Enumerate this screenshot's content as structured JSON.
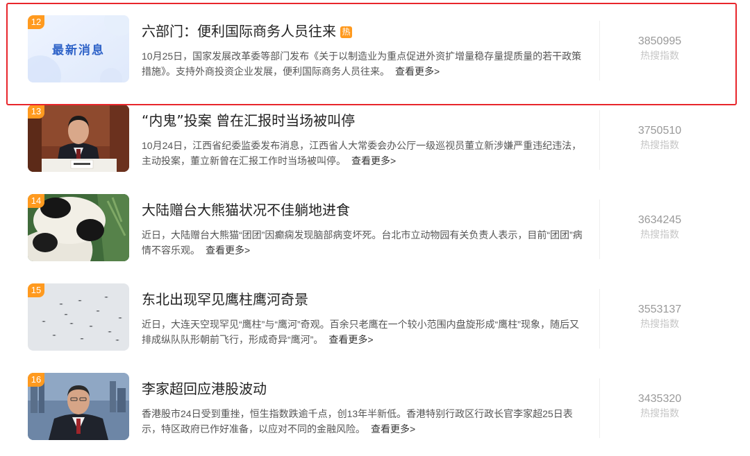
{
  "more_label": "查看更多>",
  "hot_tag_label": "热",
  "stat_label": "热搜指数",
  "colors": {
    "rank_orange": "#ff9a1f",
    "highlight_red": "#e8252b",
    "hot_tag": "#ff9a1f"
  },
  "items": [
    {
      "rank": "12",
      "title": "六部门：便利国际商务人员往来",
      "hot": true,
      "desc": "10月25日，国家发展改革委等部门发布《关于以制造业为重点促进外资扩增量稳存量提质量的若干政策措施》。支持外商投资企业发展，便利国际商务人员往来。",
      "index": "3850995",
      "thumb_text": "最新消息",
      "thumb_desc": "news-banner-image"
    },
    {
      "rank": "13",
      "title": "“内鬼”投案 曾在汇报时当场被叫停",
      "hot": false,
      "desc": "10月24日，江西省纪委监委发布消息，江西省人大常委会办公厅一级巡视员董立新涉嫌严重违纪违法，主动投案，董立新曾在汇报工作时当场被叫停。",
      "index": "3750510",
      "thumb_desc": "official-at-meeting-photo"
    },
    {
      "rank": "14",
      "title": "大陆赠台大熊猫状况不佳躺地进食",
      "hot": false,
      "desc": "近日，大陆赠台大熊猫“团团”因癫痫发现脑部病变坏死。台北市立动物园有关负责人表示，目前“团团”病情不容乐观。",
      "index": "3634245",
      "thumb_desc": "giant-panda-photo"
    },
    {
      "rank": "15",
      "title": "东北出现罕见鹰柱鹰河奇景",
      "hot": false,
      "desc": "近日，大连天空现罕见“鹰柱”与“鹰河”奇观。百余只老鹰在一个较小范围内盘旋形成“鹰柱”现象，随后又排成纵队队形朝前飞行，形成奇异“鹰河”。",
      "index": "3553137",
      "thumb_desc": "eagles-in-sky-photo"
    },
    {
      "rank": "16",
      "title": "李家超回应港股波动",
      "hot": false,
      "desc": "香港股市24日受到重挫，恒生指数跌逾千点，创13年半新低。香港特别行政区行政长官李家超25日表示，特区政府已作好准备，以应对不同的金融风险。",
      "index": "3435320",
      "thumb_desc": "official-portrait-photo"
    }
  ]
}
